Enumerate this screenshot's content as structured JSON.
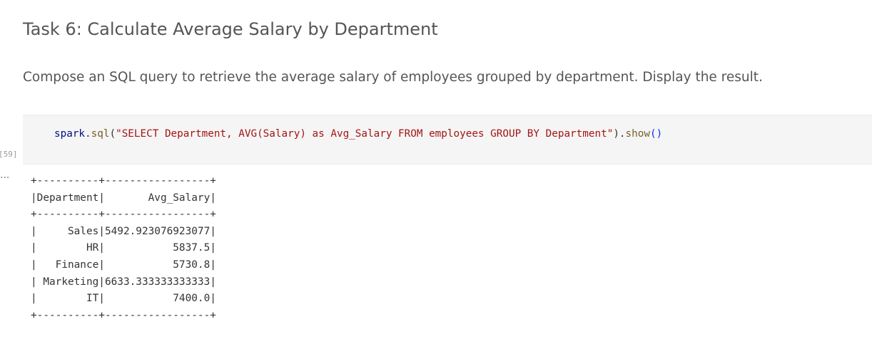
{
  "task": {
    "title": "Task 6: Calculate Average Salary by Department",
    "description": "Compose an SQL query to retrieve the average salary of employees grouped by department. Display the result."
  },
  "code_cell": {
    "execution_count": "[59]",
    "tokens": {
      "obj": "spark",
      "dot1": ".",
      "method": "sql",
      "open_paren": "(",
      "query_string": "\"SELECT Department, AVG(Salary) as Avg_Salary FROM employees GROUP BY Department\"",
      "close_paren": ")",
      "dot2": ".",
      "show_method": "show",
      "show_parens": "()"
    }
  },
  "output": {
    "more_icon": "···",
    "lines": [
      "+----------+-----------------+",
      "|Department|       Avg_Salary|",
      "+----------+-----------------+",
      "|     Sales|5492.923076923077|",
      "|        HR|           5837.5|",
      "|   Finance|           5730.8|",
      "| Marketing|6633.333333333333|",
      "|        IT|           7400.0|",
      "+----------+-----------------+"
    ]
  }
}
